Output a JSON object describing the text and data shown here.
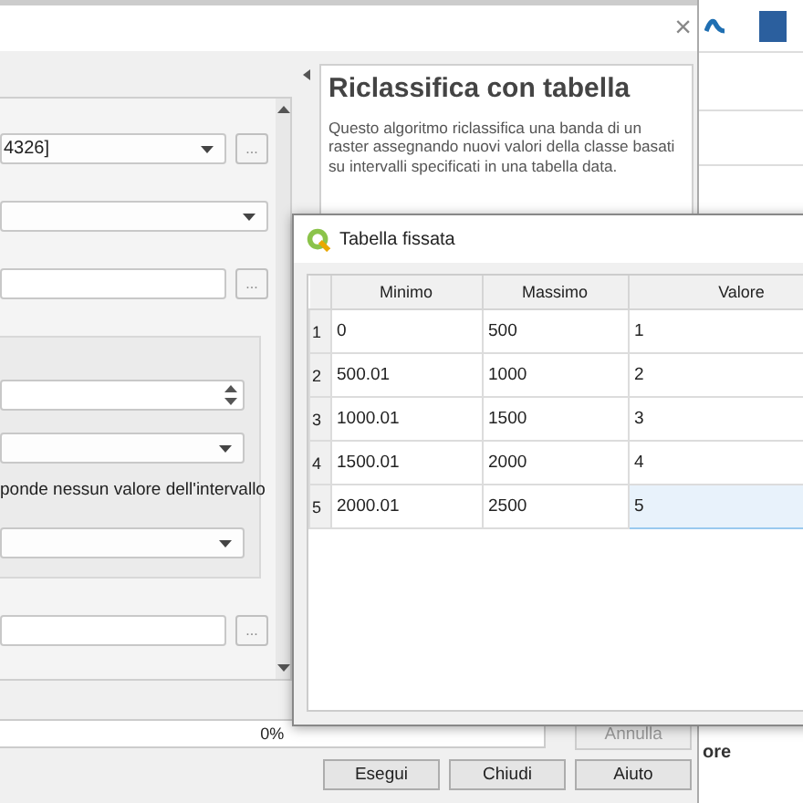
{
  "background_app": {
    "text": "ore"
  },
  "main_dialog": {
    "close_glyph": "×",
    "parameters": [
      {
        "kind": "combo",
        "value": "4326]",
        "browse": "..."
      },
      {
        "kind": "combo"
      },
      {
        "kind": "file",
        "browse": "..."
      },
      {
        "kind": "group",
        "children": [
          {
            "kind": "spin"
          },
          {
            "kind": "combo"
          },
          {
            "kind": "label",
            "text": "ponde nessun valore dell'intervallo"
          },
          {
            "kind": "combo"
          }
        ]
      },
      {
        "kind": "file",
        "browse": "..."
      }
    ],
    "help": {
      "title": "Riclassifica con tabella",
      "text": "Questo algoritmo riclassifica una banda di un raster assegnando nuovi valori della classe basati su intervalli specificati in una tabella data."
    },
    "progress": {
      "label": "0%",
      "level": 0
    },
    "cancel_button": {
      "label": "Annulla",
      "disabled": true
    },
    "buttons": [
      {
        "label": "Esegui",
        "disabled": false
      },
      {
        "label": "Chiudi",
        "disabled": false
      },
      {
        "label": "Aiuto",
        "disabled": false
      }
    ]
  },
  "table_dialog": {
    "title": "Tabella fissata",
    "columns": [
      "Minimo",
      "Massimo",
      "Valore"
    ],
    "rows": [
      {
        "index": "1",
        "cells": [
          {
            "text": "0",
            "selected": false
          },
          {
            "text": "500",
            "selected": false
          },
          {
            "text": "1",
            "selected": false
          }
        ]
      },
      {
        "index": "2",
        "cells": [
          {
            "text": "500.01",
            "selected": false
          },
          {
            "text": "1000",
            "selected": false
          },
          {
            "text": "2",
            "selected": false
          }
        ]
      },
      {
        "index": "3",
        "cells": [
          {
            "text": "1000.01",
            "selected": false
          },
          {
            "text": "1500",
            "selected": false
          },
          {
            "text": "3",
            "selected": false
          }
        ]
      },
      {
        "index": "4",
        "cells": [
          {
            "text": "1500.01",
            "selected": false
          },
          {
            "text": "2000",
            "selected": false
          },
          {
            "text": "4",
            "selected": false
          }
        ]
      },
      {
        "index": "5",
        "cells": [
          {
            "text": "2000.01",
            "selected": false
          },
          {
            "text": "2500",
            "selected": false
          },
          {
            "text": "5",
            "selected": true
          }
        ]
      }
    ]
  }
}
